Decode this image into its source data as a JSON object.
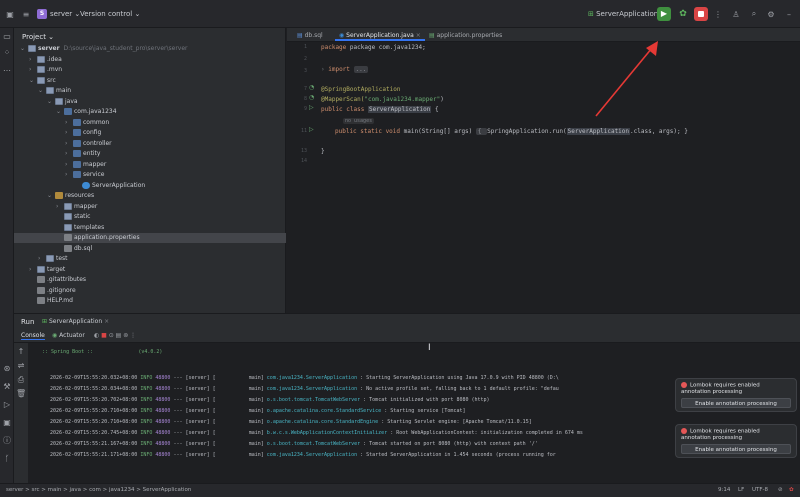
{
  "titlebar": {
    "project_badge": "S",
    "project_name": "server",
    "vcs": "Version control",
    "run_config": "ServerApplication"
  },
  "project": {
    "header": "Project",
    "root_name": "server",
    "root_path": "D:\\source\\java_student_pro\\server\\server",
    "tree": [
      {
        "label": "server",
        "indent": 0,
        "type": "folder",
        "open": true
      },
      {
        "label": ".idea",
        "indent": 1,
        "type": "folder",
        "open": false
      },
      {
        "label": ".mvn",
        "indent": 1,
        "type": "folder",
        "open": false
      },
      {
        "label": "src",
        "indent": 1,
        "type": "folder",
        "open": true
      },
      {
        "label": "main",
        "indent": 2,
        "type": "folder",
        "open": true
      },
      {
        "label": "java",
        "indent": 3,
        "type": "folder",
        "open": true
      },
      {
        "label": "com.java1234",
        "indent": 4,
        "type": "pkg",
        "open": true
      },
      {
        "label": "common",
        "indent": 5,
        "type": "pkg",
        "open": false
      },
      {
        "label": "config",
        "indent": 5,
        "type": "pkg",
        "open": false
      },
      {
        "label": "controller",
        "indent": 5,
        "type": "pkg",
        "open": false
      },
      {
        "label": "entity",
        "indent": 5,
        "type": "pkg",
        "open": false
      },
      {
        "label": "mapper",
        "indent": 5,
        "type": "pkg",
        "open": false
      },
      {
        "label": "service",
        "indent": 5,
        "type": "pkg",
        "open": false
      },
      {
        "label": "ServerApplication",
        "indent": 6,
        "type": "java"
      },
      {
        "label": "resources",
        "indent": 3,
        "type": "res",
        "open": true
      },
      {
        "label": "mapper",
        "indent": 4,
        "type": "folder",
        "open": false
      },
      {
        "label": "static",
        "indent": 4,
        "type": "folder"
      },
      {
        "label": "templates",
        "indent": 4,
        "type": "folder"
      },
      {
        "label": "application.properties",
        "indent": 4,
        "type": "file",
        "selected": true
      },
      {
        "label": "db.sql",
        "indent": 4,
        "type": "file"
      },
      {
        "label": "test",
        "indent": 2,
        "type": "folder",
        "open": false
      },
      {
        "label": "target",
        "indent": 1,
        "type": "folder",
        "open": false
      },
      {
        "label": ".gitattributes",
        "indent": 1,
        "type": "file"
      },
      {
        "label": ".gitignore",
        "indent": 1,
        "type": "file"
      },
      {
        "label": "HELP.md",
        "indent": 1,
        "type": "file"
      }
    ]
  },
  "editor": {
    "tabs": [
      "db.sql",
      "ServerApplication.java",
      "application.properties"
    ],
    "active_tab": 1,
    "lines": {
      "l1": "package com.java1234;",
      "l3_kw": "import",
      "l3_fold": "...",
      "l7": "@SpringBootApplication",
      "l8_ann": "@MapperScan(",
      "l8_str": "\"com.java1234.mapper\"",
      "l8_end": ")",
      "l9_kw": "public class ",
      "l9_cls": "ServerApplication",
      "l9_end": " {",
      "l10_hint": "no usages",
      "l11_kw": "public static void ",
      "l11_mid": "main(String[] args) ",
      "l11_brace": "{ ",
      "l11_call": "SpringApplication.run(",
      "l11_arg": "ServerApplication",
      "l11_tail": ".class, args); }",
      "l13": "}"
    },
    "line_numbers": [
      "1",
      "2",
      "3",
      "",
      "",
      "",
      "7",
      "8",
      "9",
      "",
      "11",
      "",
      "13",
      "14"
    ]
  },
  "run": {
    "tab_run": "Run",
    "config": "ServerApplication",
    "console_tab": "Console",
    "actuator_tab": "Actuator",
    "banner": "  :: Spring Boot ::               (v4.0.2)",
    "logs": [
      {
        "ts": "2026-02-09T15:55:20.032+08:00",
        "lvl": "INFO",
        "pid": "48800",
        "thr": "--- [server] [           main]",
        "cls": "com.java1234.ServerApplication",
        "msg": ": Starting ServerApplication using Java 17.0.9 with PID 48800 (D:\\"
      },
      {
        "ts": "2026-02-09T15:55:20.034+08:00",
        "lvl": "INFO",
        "pid": "48800",
        "thr": "--- [server] [           main]",
        "cls": "com.java1234.ServerApplication",
        "msg": ": No active profile set, falling back to 1 default profile: \"defau"
      },
      {
        "ts": "2026-02-09T15:55:20.702+08:00",
        "lvl": "INFO",
        "pid": "48800",
        "thr": "--- [server] [           main]",
        "cls": "o.s.boot.tomcat.TomcatWebServer",
        "msg": ": Tomcat initialized with port 8080 (http)"
      },
      {
        "ts": "2026-02-09T15:55:20.710+08:00",
        "lvl": "INFO",
        "pid": "48800",
        "thr": "--- [server] [           main]",
        "cls": "o.apache.catalina.core.StandardService",
        "msg": ": Starting service [Tomcat]"
      },
      {
        "ts": "2026-02-09T15:55:20.710+08:00",
        "lvl": "INFO",
        "pid": "48800",
        "thr": "--- [server] [           main]",
        "cls": "o.apache.catalina.core.StandardEngine",
        "msg": ": Starting Servlet engine: [Apache Tomcat/11.0.15]"
      },
      {
        "ts": "2026-02-09T15:55:20.745+08:00",
        "lvl": "INFO",
        "pid": "48800",
        "thr": "--- [server] [           main]",
        "cls": "b.w.c.s.WebApplicationContextInitializer",
        "msg": ": Root WebApplicationContext: initialization completed in 674 ms"
      },
      {
        "ts": "2026-02-09T15:55:21.167+08:00",
        "lvl": "INFO",
        "pid": "48800",
        "thr": "--- [server] [           main]",
        "cls": "o.s.boot.tomcat.TomcatWebServer",
        "msg": ": Tomcat started on port 8080 (http) with context path '/'"
      },
      {
        "ts": "2026-02-09T15:55:21.171+08:00",
        "lvl": "INFO",
        "pid": "48800",
        "thr": "--- [server] [           main]",
        "cls": "com.java1234.ServerApplication",
        "msg": ": Started ServerApplication in 1.454 seconds (process running for"
      }
    ]
  },
  "notifications": [
    {
      "message": "Lombok requires enabled annotation processing",
      "button": "Enable annotation processing"
    },
    {
      "message": "Lombok requires enabled annotation processing",
      "button": "Enable annotation processing"
    }
  ],
  "statusbar": {
    "breadcrumb": "server > src > main > java > com > java1234 > ServerApplication",
    "position": "9:14",
    "line_sep": "LF",
    "encoding": "UTF-8"
  },
  "colors": {
    "accent": "#3574f0",
    "run_green": "#3f8f3f",
    "stop_red": "#d94545",
    "arrow_red": "#e53935"
  }
}
